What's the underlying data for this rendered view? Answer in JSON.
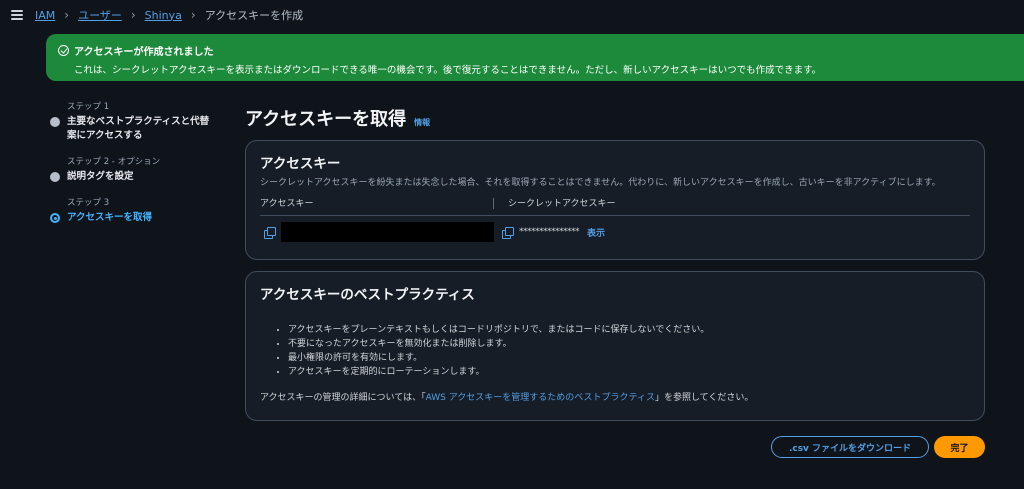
{
  "breadcrumb": {
    "items": [
      "IAM",
      "ユーザー",
      "Shinya"
    ],
    "current": "アクセスキーを作成"
  },
  "flash": {
    "title": "アクセスキーが作成されました",
    "message": "これは、シークレットアクセスキーを表示またはダウンロードできる唯一の機会です。後で復元することはできません。ただし、新しいアクセスキーはいつでも作成できます。",
    "color": "#1d8a3b"
  },
  "steps": [
    {
      "number": "ステップ 1",
      "title": "主要なベストプラクティスと代替案にアクセスする",
      "state": "done"
    },
    {
      "number": "ステップ 2 - オプション",
      "title": "説明タグを設定",
      "state": "done"
    },
    {
      "number": "ステップ 3",
      "title": "アクセスキーを取得",
      "state": "active"
    }
  ],
  "page": {
    "title": "アクセスキーを取得",
    "info_link": "情報"
  },
  "access_key_card": {
    "title": "アクセスキー",
    "description": "シークレットアクセスキーを紛失または失念した場合、それを取得することはできません。代わりに、新しいアクセスキーを作成し、古いキーを非アクティブにします。",
    "col_access_key": "アクセスキー",
    "col_secret_key": "シークレットアクセスキー",
    "secret_mask": "***************",
    "show_label": "表示"
  },
  "best_practices_card": {
    "title": "アクセスキーのベストプラクティス",
    "bullets": [
      "アクセスキーをプレーンテキストもしくはコードリポジトリで、またはコードに保存しないでください。",
      "不要になったアクセスキーを無効化または削除します。",
      "最小権限の許可を有効にします。",
      "アクセスキーを定期的にローテーションします。"
    ],
    "more_info_prefix": "アクセスキーの管理の詳細については、「",
    "more_info_link": "AWS アクセスキーを管理するためのベストプラクティス",
    "more_info_suffix": "」を参照してください。"
  },
  "actions": {
    "download_label": ".csv ファイルをダウンロード",
    "done_label": "完了"
  },
  "colors": {
    "accent": "#539fe5",
    "primary_button": "#ff9900",
    "active_step": "#42b4ff"
  }
}
